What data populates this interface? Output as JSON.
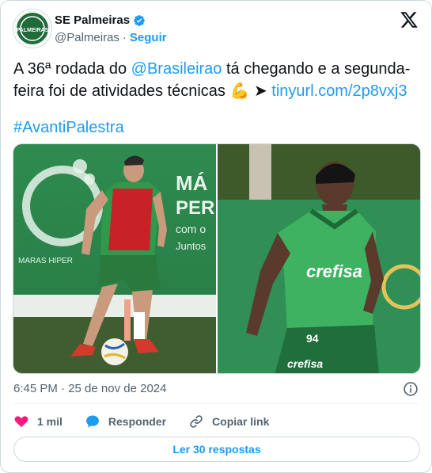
{
  "author": {
    "display_name": "SE Palmeiras",
    "handle": "@Palmeiras",
    "separator": "·",
    "follow_label": "Seguir",
    "avatar_text": "PALMEIRAS"
  },
  "tweet": {
    "text_before_mention": "A 36ª rodada do ",
    "mention": "@Brasileirao",
    "text_after_mention": " tá chegando e a segunda-feira foi de atividades técnicas ",
    "emoji": "💪",
    "arrow": " ➤ ",
    "link": "tinyurl.com/2p8vxj3",
    "hashtag": "#AvantiPalestra"
  },
  "media": {
    "left_photo_text": [
      "MÁ",
      "PER",
      "com o",
      "Juntos",
      "MARAS HIPER"
    ],
    "right_photo_text": [
      "crefisa",
      "crefisa",
      "94"
    ]
  },
  "meta": {
    "timestamp": "6:45 PM · 25 de nov de 2024"
  },
  "actions": {
    "likes": "1 mil",
    "reply": "Responder",
    "copy_link": "Copiar link"
  },
  "read_replies": "Ler 30 respostas",
  "colors": {
    "accent": "#1d9bf0",
    "secondary_text": "#536471",
    "like": "#f91880",
    "border": "#cfd9de"
  },
  "icons": {
    "verified": "verified-badge-icon",
    "x_logo": "x-logo-icon",
    "info": "info-icon",
    "heart": "heart-icon",
    "reply": "reply-bubble-icon",
    "link": "link-icon"
  }
}
